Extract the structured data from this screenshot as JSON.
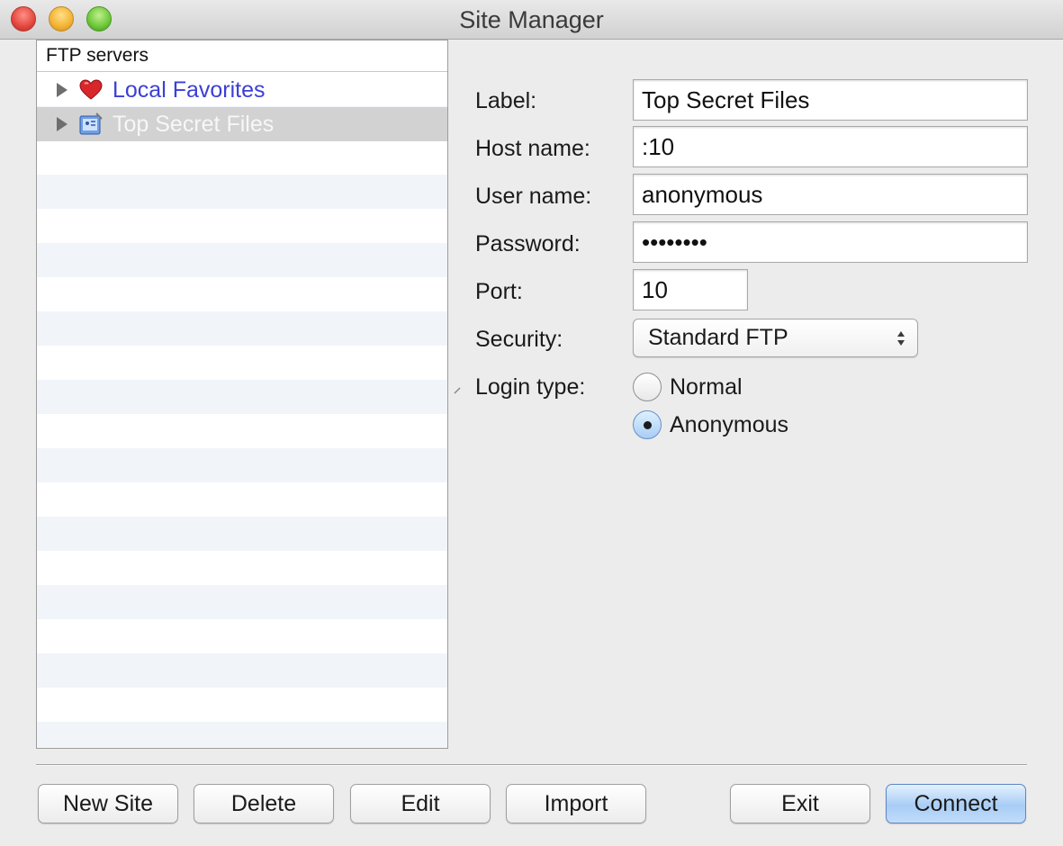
{
  "window": {
    "title": "Site Manager"
  },
  "tree": {
    "header": "FTP servers",
    "items": [
      {
        "label": "Local Favorites",
        "icon": "heart-icon",
        "selected": false
      },
      {
        "label": "Top Secret Files",
        "icon": "server-icon",
        "selected": true
      }
    ]
  },
  "form": {
    "label": {
      "label": "Label:",
      "value": "Top Secret Files"
    },
    "host": {
      "label": "Host name:",
      "value": ":10"
    },
    "user": {
      "label": "User name:",
      "value": "anonymous"
    },
    "password": {
      "label": "Password:",
      "value": "••••••••"
    },
    "port": {
      "label": "Port:",
      "value": "10"
    },
    "security": {
      "label": "Security:",
      "value": "Standard FTP"
    },
    "login_type": {
      "label": "Login type:",
      "options": [
        "Normal",
        "Anonymous"
      ],
      "selected": "Anonymous"
    }
  },
  "buttons": {
    "new_site": "New Site",
    "delete": "Delete",
    "edit": "Edit",
    "import": "Import",
    "exit": "Exit",
    "connect": "Connect"
  },
  "colors": {
    "favorites_text": "#3b3fd6",
    "selection": "#d2d2d2",
    "primary_button": "#a8cdf5"
  }
}
